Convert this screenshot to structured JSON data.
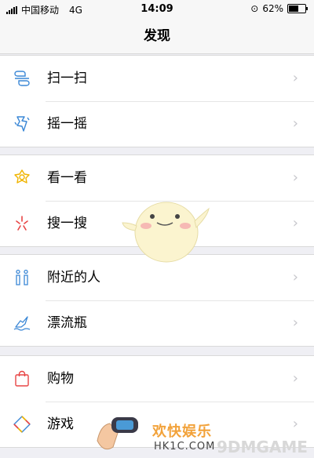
{
  "status": {
    "carrier": "中国移动",
    "network": "4G",
    "time": "14:09",
    "battery": "62%",
    "battery_level": 0.62
  },
  "nav": {
    "title": "发现"
  },
  "groups": [
    {
      "items": [
        {
          "label": "扫一扫",
          "icon": "scan-icon"
        },
        {
          "label": "摇一摇",
          "icon": "shake-icon"
        }
      ]
    },
    {
      "items": [
        {
          "label": "看一看",
          "icon": "look-icon"
        },
        {
          "label": "搜一搜",
          "icon": "search-icon"
        }
      ]
    },
    {
      "items": [
        {
          "label": "附近的人",
          "icon": "nearby-people-icon"
        },
        {
          "label": "漂流瓶",
          "icon": "drift-bottle-icon"
        }
      ]
    },
    {
      "items": [
        {
          "label": "购物",
          "icon": "shopping-icon"
        },
        {
          "label": "游戏",
          "icon": "game-icon"
        }
      ]
    }
  ],
  "chevron": "›",
  "watermark": {
    "site_cn": "欢快娱乐",
    "site_url": "HK1C.COM",
    "brand": "9DMGAME"
  },
  "colors": {
    "accent_blue": "#3a87d6",
    "look_yellow": "#f0b400",
    "search_red": "#e84545",
    "shopping_red": "#e84545",
    "watermark_orange": "#f2a23a"
  }
}
